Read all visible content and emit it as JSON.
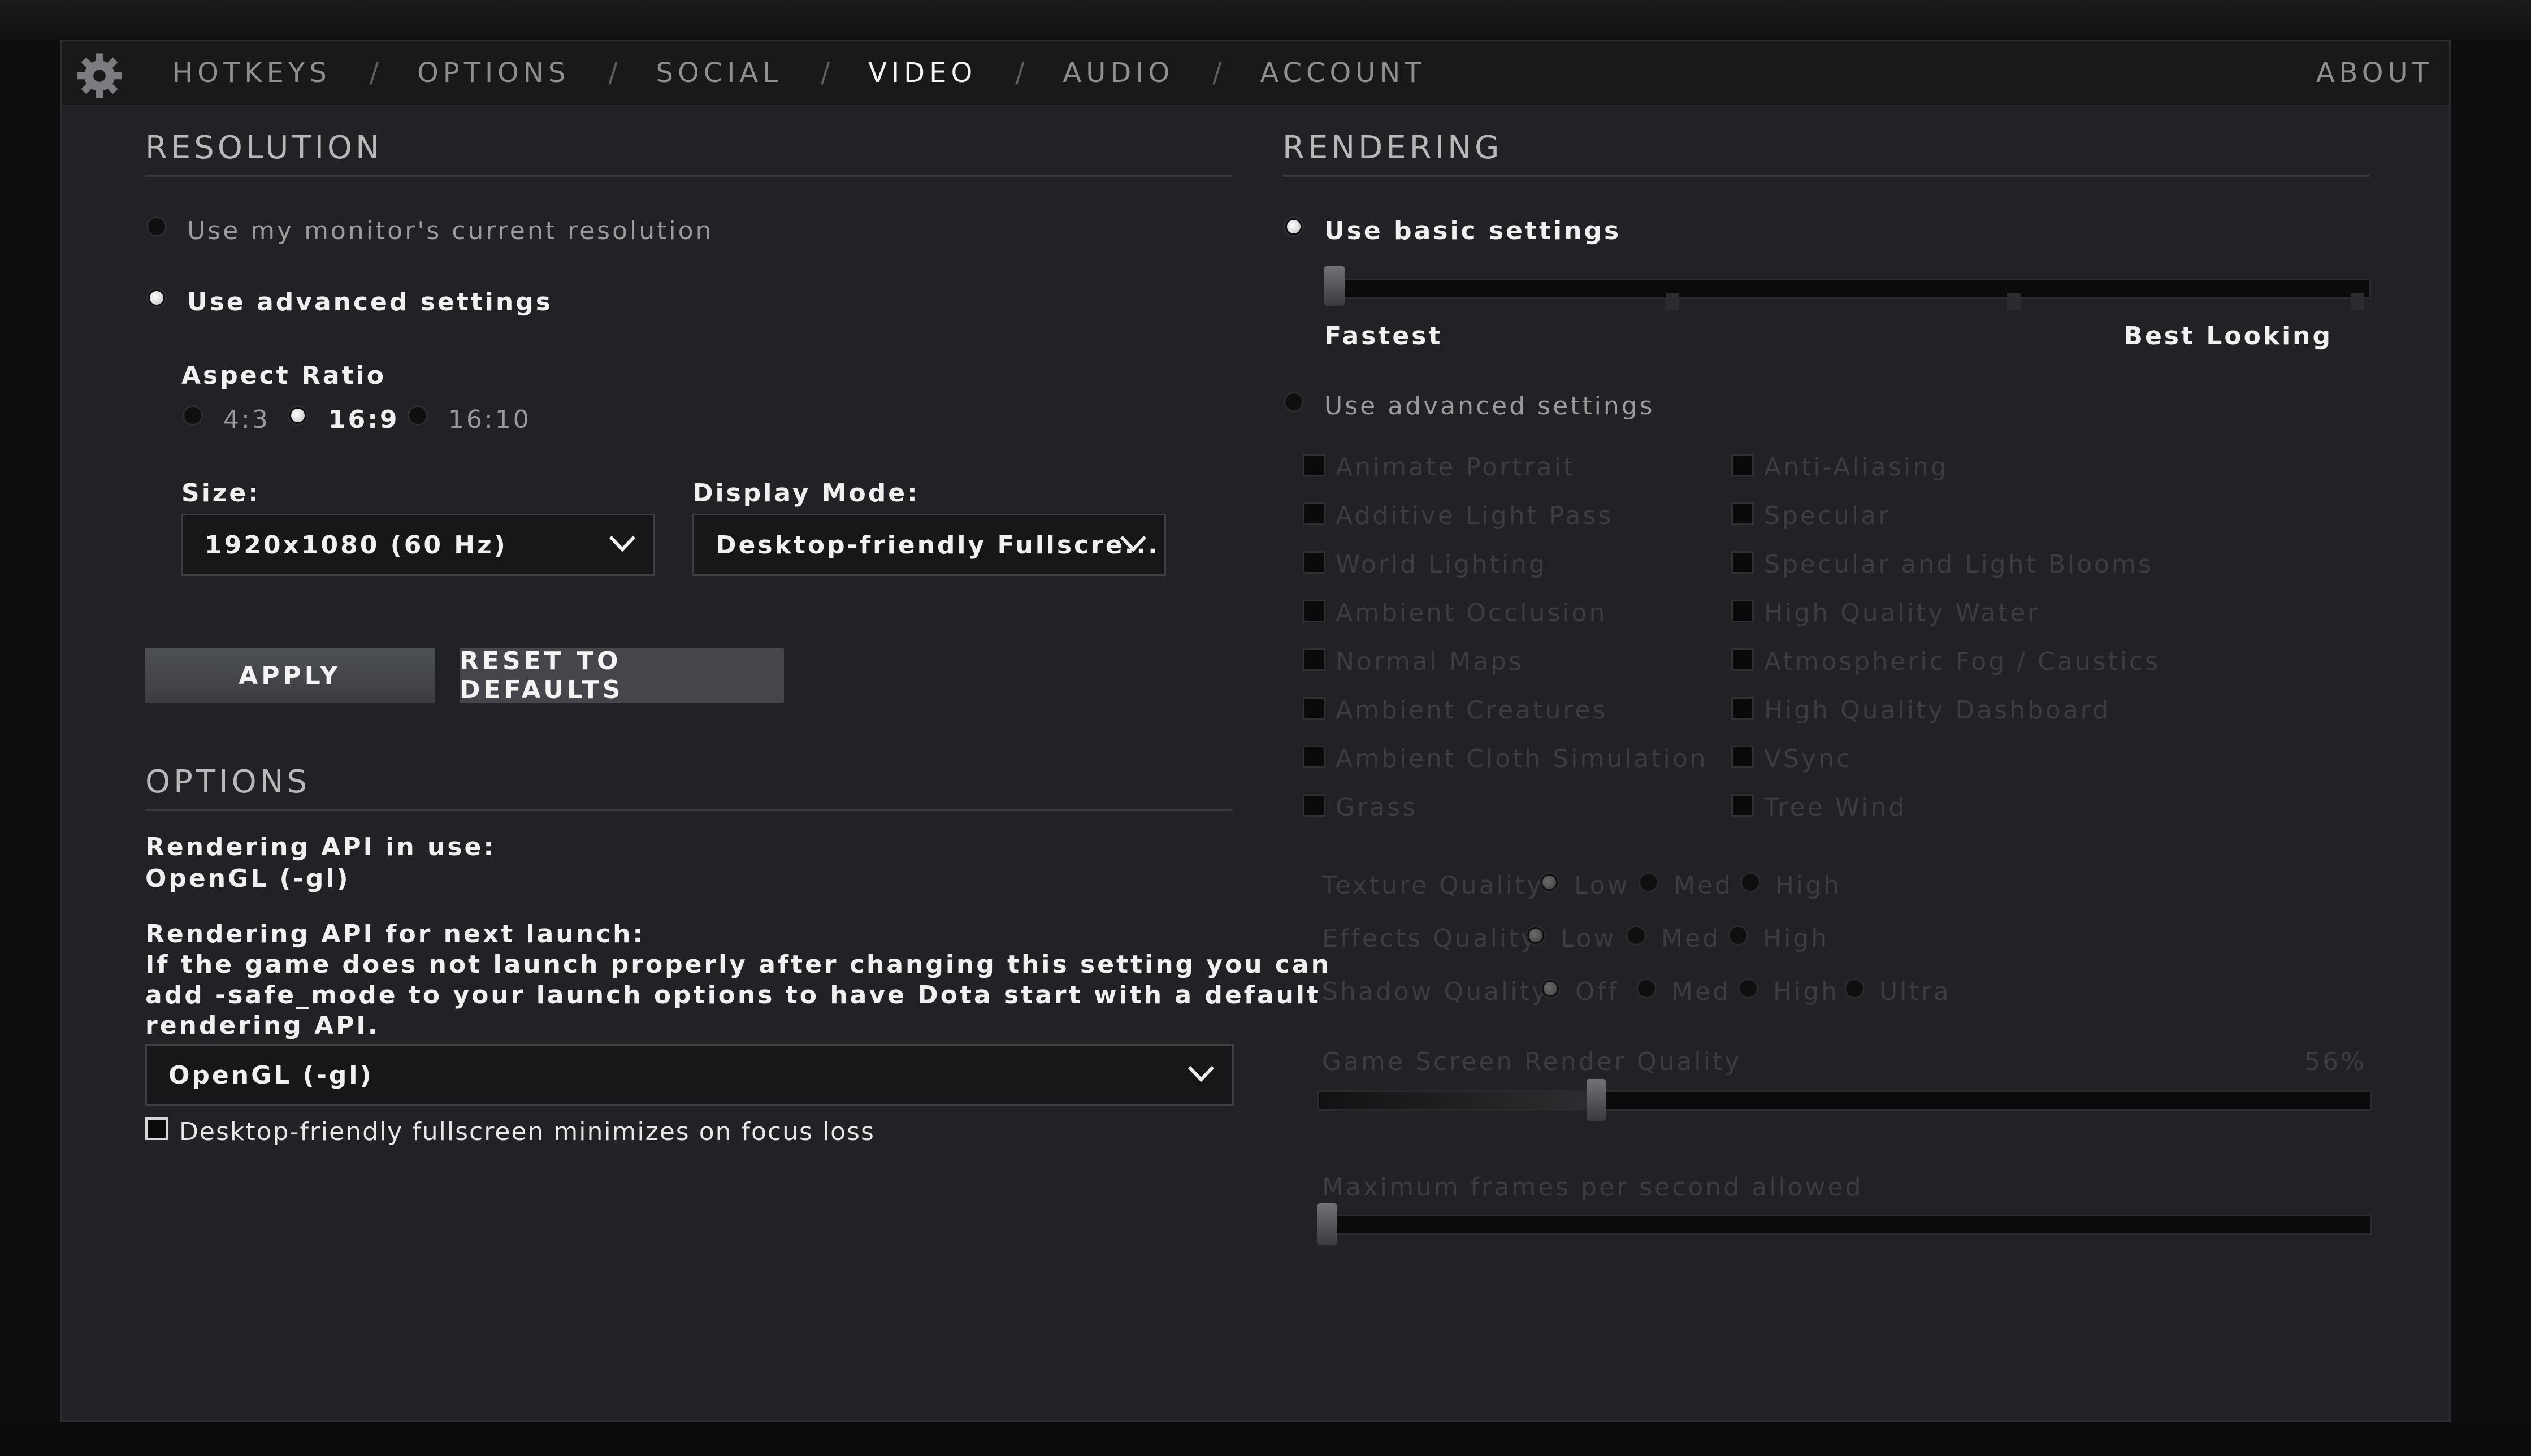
{
  "nav": {
    "items": [
      "HOTKEYS",
      "OPTIONS",
      "SOCIAL",
      "VIDEO",
      "AUDIO",
      "ACCOUNT"
    ],
    "active": "VIDEO",
    "separator": "/",
    "about": "ABOUT"
  },
  "resolution": {
    "title": "RESOLUTION",
    "monitor_option": "Use my monitor's current resolution",
    "advanced_option": "Use advanced settings",
    "aspect_label": "Aspect Ratio",
    "aspect_options": [
      "4:3",
      "16:9",
      "16:10"
    ],
    "aspect_selected": "16:9",
    "size_label": "Size:",
    "size_value": "1920x1080 (60 Hz)",
    "display_mode_label": "Display Mode:",
    "display_mode_value": "Desktop-friendly Fullscre...",
    "apply": "APPLY",
    "reset": "RESET TO DEFAULTS"
  },
  "options": {
    "title": "OPTIONS",
    "api_in_use_label": "Rendering API in use:",
    "api_in_use_value": "OpenGL (-gl)",
    "api_next_label": "Rendering API for next launch:",
    "api_note_line1": "If the game does not launch properly after changing this setting you can",
    "api_note_line2": "add -safe_mode to your launch options to have Dota start with a default",
    "api_note_line3": "rendering API.",
    "api_next_value": "OpenGL (-gl)",
    "minimize_checkbox": "Desktop-friendly fullscreen minimizes on focus loss",
    "minimize_checked": false
  },
  "rendering": {
    "title": "RENDERING",
    "basic_option": "Use basic settings",
    "basic_selected": true,
    "slider_min_label": "Fastest",
    "slider_max_label": "Best Looking",
    "basic_level": 0,
    "advanced_option": "Use advanced settings",
    "checkboxes_left": [
      "Animate Portrait",
      "Additive Light Pass",
      "World Lighting",
      "Ambient Occlusion",
      "Normal Maps",
      "Ambient Creatures",
      "Ambient Cloth Simulation",
      "Grass"
    ],
    "checkboxes_right": [
      "Anti-Aliasing",
      "Specular",
      "Specular and Light Blooms",
      "High Quality Water",
      "Atmospheric Fog / Caustics",
      "High Quality Dashboard",
      "VSync",
      "Tree Wind"
    ],
    "texture_label": "Texture Quality",
    "texture_options": [
      "Low",
      "Med",
      "High"
    ],
    "texture_selected": "Low",
    "effects_label": "Effects Quality",
    "effects_options": [
      "Low",
      "Med",
      "High"
    ],
    "effects_selected": "Low",
    "shadow_label": "Shadow Quality",
    "shadow_options": [
      "Off",
      "Med",
      "High",
      "Ultra"
    ],
    "shadow_selected": "Off",
    "render_quality_label": "Game Screen Render Quality",
    "render_quality_value": "56%",
    "render_quality_fraction": 0.26,
    "max_fps_label": "Maximum frames per second allowed",
    "max_fps_fraction": 0.0
  }
}
